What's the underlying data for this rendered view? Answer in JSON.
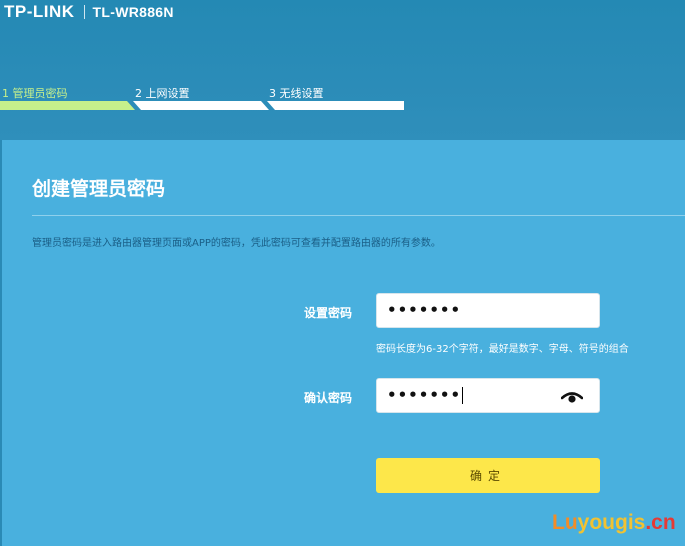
{
  "header": {
    "logo": "TP-LINK",
    "model": "TL-WR886N"
  },
  "steps": [
    {
      "label": "1 管理员密码",
      "active": true
    },
    {
      "label": "2 上网设置",
      "active": false
    },
    {
      "label": "3 无线设置",
      "active": false
    }
  ],
  "main": {
    "title": "创建管理员密码",
    "description": "管理员密码是进入路由器管理页面或APP的密码，凭此密码可查看并配置路由器的所有参数。",
    "password": {
      "label": "设置密码",
      "value": "•••••••",
      "hint": "密码长度为6-32个字符，最好是数字、字母、符号的组合"
    },
    "confirm_password": {
      "label": "确认密码",
      "value": "•••••••"
    },
    "confirm_button": "确定"
  },
  "watermark": {
    "part1": "Lu",
    "part2": "yougis",
    "part3": ".cn"
  },
  "colors": {
    "header_bg": "#2a8ab5",
    "panel_bg": "#49b0de",
    "active_step": "#c6f08b",
    "button": "#fde74a"
  }
}
